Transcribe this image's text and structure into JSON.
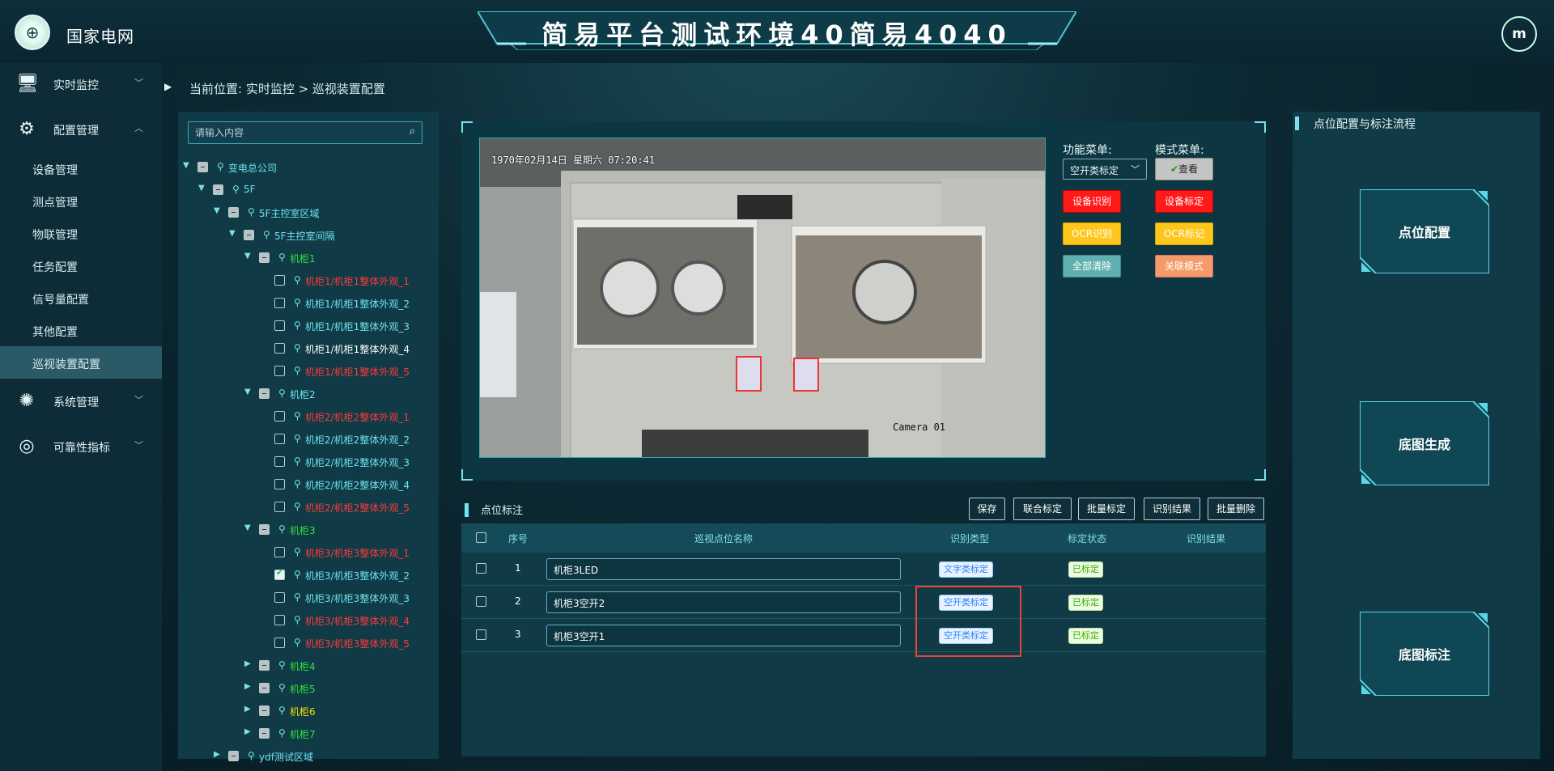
{
  "header": {
    "brand": "国家电网",
    "title": "简易平台测试环境40简易4040",
    "user_initial": "m"
  },
  "sidebar": {
    "monitor": {
      "label": "实时监控",
      "icon": "monitor-icon"
    },
    "config": {
      "label": "配置管理",
      "icon": "sliders-icon"
    },
    "config_items": [
      "设备管理",
      "测点管理",
      "物联管理",
      "任务配置",
      "信号量配置",
      "其他配置",
      "巡视装置配置"
    ],
    "system": {
      "label": "系统管理",
      "icon": "gear-icon"
    },
    "reliability": {
      "label": "可靠性指标",
      "icon": "target-icon"
    }
  },
  "breadcrumb": "当前位置: 实时监控 > 巡视装置配置",
  "search": {
    "placeholder": "请输入内容"
  },
  "tree": [
    {
      "label": "变电总公司",
      "color": "w"
    },
    {
      "label": "5F",
      "color": "w"
    },
    {
      "label": "5F主控室区域",
      "color": "w"
    },
    {
      "label": "5F主控室间隔",
      "color": "w"
    },
    {
      "label": "机柜1",
      "color": "g"
    },
    {
      "label": "机柜1/机柜1整体外观_1",
      "color": "r"
    },
    {
      "label": "机柜1/机柜1整体外观_2",
      "color": "w"
    },
    {
      "label": "机柜1/机柜1整体外观_3",
      "color": "w"
    },
    {
      "label": "机柜1/机柜1整体外观_4",
      "color": "wh"
    },
    {
      "label": "机柜1/机柜1整体外观_5",
      "color": "r"
    },
    {
      "label": "机柜2",
      "color": "w"
    },
    {
      "label": "机柜2/机柜2整体外观_1",
      "color": "r"
    },
    {
      "label": "机柜2/机柜2整体外观_2",
      "color": "w"
    },
    {
      "label": "机柜2/机柜2整体外观_3",
      "color": "w"
    },
    {
      "label": "机柜2/机柜2整体外观_4",
      "color": "w"
    },
    {
      "label": "机柜2/机柜2整体外观_5",
      "color": "r"
    },
    {
      "label": "机柜3",
      "color": "g"
    },
    {
      "label": "机柜3/机柜3整体外观_1",
      "color": "r"
    },
    {
      "label": "机柜3/机柜3整体外观_2",
      "color": "w"
    },
    {
      "label": "机柜3/机柜3整体外观_3",
      "color": "w"
    },
    {
      "label": "机柜3/机柜3整体外观_4",
      "color": "r"
    },
    {
      "label": "机柜3/机柜3整体外观_5",
      "color": "r"
    },
    {
      "label": "机柜4",
      "color": "g"
    },
    {
      "label": "机柜5",
      "color": "g"
    },
    {
      "label": "机柜6",
      "color": "y"
    },
    {
      "label": "机柜7",
      "color": "g"
    },
    {
      "label": "ydf测试区域",
      "color": "w"
    }
  ],
  "camera": {
    "timestamp": "1970年02月14日  星期六  07:20:41",
    "name": "Camera 01"
  },
  "func_menu": {
    "label": "功能菜单:",
    "selected": "空开类标定",
    "buttons": [
      "设备识别",
      "OCR识别",
      "全部清除"
    ]
  },
  "mode_menu": {
    "label": "模式菜单:",
    "buttons": [
      "查看",
      "设备标定",
      "OCR标记",
      "关联模式"
    ]
  },
  "points": {
    "title": "点位标注",
    "toolbar": [
      "保存",
      "联合标定",
      "批量标定",
      "识别结果",
      "批量删除"
    ],
    "columns": [
      "序号",
      "巡视点位名称",
      "识别类型",
      "标定状态",
      "识别结果"
    ],
    "rows": [
      {
        "index": "1",
        "name": "机柜3LED",
        "type": "文字类标定",
        "status": "已标定",
        "result": ""
      },
      {
        "index": "2",
        "name": "机柜3空开2",
        "type": "空开类标定",
        "status": "已标定",
        "result": ""
      },
      {
        "index": "3",
        "name": "机柜3空开1",
        "type": "空开类标定",
        "status": "已标定",
        "result": ""
      }
    ]
  },
  "flow": {
    "title": "点位配置与标注流程",
    "steps": [
      "点位配置",
      "底图生成",
      "底图标注"
    ]
  },
  "colors": {
    "accent": "#7ae1ee",
    "red": "#ff1a1a",
    "yellow": "#ffc71c",
    "green_text": "#2fe23b",
    "red_text": "#ff3a3a"
  }
}
